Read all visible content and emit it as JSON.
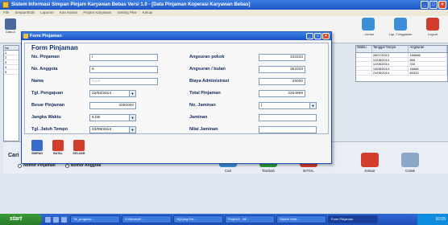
{
  "app": {
    "title": "Sistem Informasi Simpan Pinjam Karyawan Bebas Versi 1.0 - [Data Pinjaman Koperasi Karyawan Bebas]",
    "menu": [
      "File",
      "Simpan/Edit",
      "Laporan",
      "Kas Harian",
      "Pinjam Karyawan",
      "Setting Pkw",
      "Keluar"
    ]
  },
  "toolbar": {
    "left_label": "Data A",
    "right_items": [
      {
        "label": "...inman",
        "color": "#3a8fd8"
      },
      {
        "label": "Lap. Tunggakan",
        "color": "#3a8fd8"
      },
      {
        "label": "Logout",
        "color": "#d23c2c"
      }
    ]
  },
  "grid": {
    "headers": [
      "Waktu",
      "Tanggal Tempo",
      "Angsuran"
    ],
    "rows": [
      [
        "",
        "26/07/2013",
        "166666"
      ],
      [
        "",
        "12/08/2014",
        "666"
      ],
      [
        "",
        "12/06/2014",
        "333"
      ],
      [
        "",
        "13/08/2014",
        "16666"
      ],
      [
        "",
        "21/06/2014",
        "83333"
      ]
    ]
  },
  "leftgrid": {
    "head": "No",
    "rows": [
      "1",
      "2",
      "3",
      "4",
      "5"
    ]
  },
  "cari": {
    "label": "Cari",
    "radio1": "Nomor Pinjaman",
    "radio2": "Nomor Anggota"
  },
  "bottom_buttons": [
    {
      "label": "Cari",
      "color": "#3a8fd8"
    },
    {
      "label": "Tambah",
      "color": "#2f9a3c"
    },
    {
      "label": "BATAL",
      "color": "#d23c2c"
    },
    {
      "label": "Keluar",
      "color": "#d23c2c"
    },
    {
      "label": "Cetak",
      "color": "#8aa6c8"
    }
  ],
  "dialog": {
    "title": "Form Pinjaman",
    "form_title": "Form Pinjaman",
    "fields": {
      "no_pinjaman": {
        "label": "No. Pinjaman",
        "value": "I"
      },
      "no_anggota": {
        "label": "No. Anggota",
        "value": "6"
      },
      "nama": {
        "label": "Nama",
        "value": "sope"
      },
      "tgl_pengajuan": {
        "label": "Tgl. Pengajuan",
        "value": "22/02/2014"
      },
      "besar_pinjaman": {
        "label": "Besar Pinjaman",
        "value": "2000000"
      },
      "jangka_waktu": {
        "label": "Jangka Waktu",
        "value": "6 bln"
      },
      "tgl_jatuh_tempo": {
        "label": "Tgl. Jatuh Tempo",
        "value": "22/08/2014"
      },
      "angsuran_pokok": {
        "label": "Angsuran pokok",
        "value": "333333"
      },
      "angsuran_bulan": {
        "label": "Angsuran / bulan",
        "value": "363333"
      },
      "biaya_admin": {
        "label": "Biaya Administrasi",
        "value": "25000"
      },
      "total_pinjaman": {
        "label": "Total Pinjaman",
        "value": "2204999"
      },
      "no_jaminan": {
        "label": "No. Jaminan",
        "value": "|"
      },
      "jaminan": {
        "label": "Jaminan",
        "value": ""
      },
      "nilai_jaminan": {
        "label": "Nilai Jaminan",
        "value": ""
      }
    },
    "buttons": [
      {
        "label": "SIMPAN",
        "color": "#3a6bc8"
      },
      {
        "label": "BATAL",
        "color": "#d23c2c"
      },
      {
        "label": "KELUAR",
        "color": "#d23c2c"
      }
    ]
  },
  "taskbar": {
    "start": "start",
    "tasks": [
      "TA_program...",
      "3 Microsoft...",
      "SQLyog Ent...",
      "Project1 - Mi...",
      "Sistem Infor...",
      "Form Pinjaman"
    ],
    "clock": "10:05"
  }
}
